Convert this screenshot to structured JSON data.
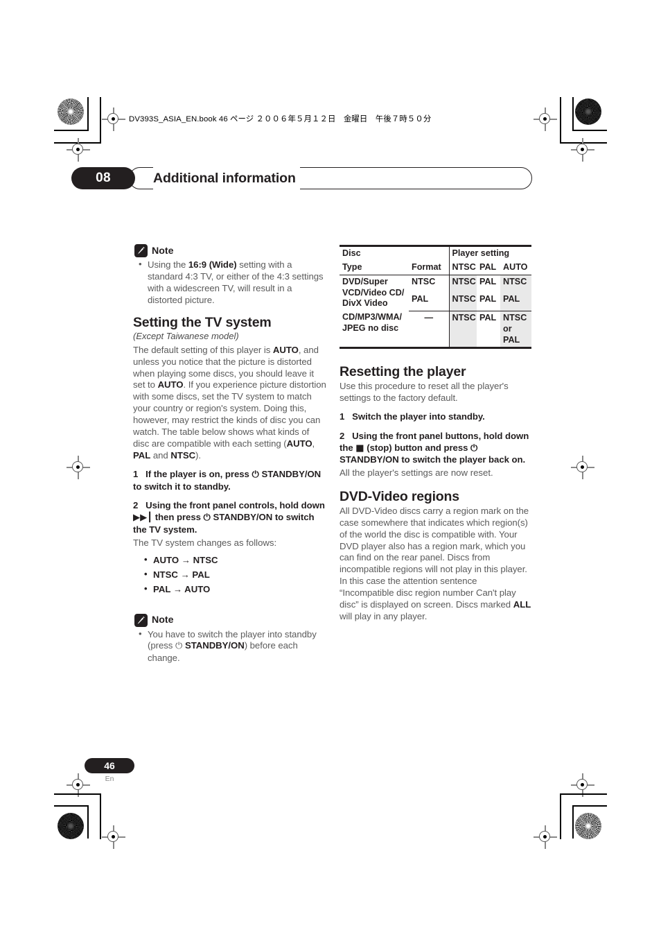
{
  "print_header": {
    "text": "DV393S_ASIA_EN.book  46 ページ  ２００６年５月１２日　金曜日　午後７時５０分"
  },
  "chapter": {
    "number": "08",
    "title": "Additional information"
  },
  "left_column": {
    "note_top": {
      "icon": "pencil-note-icon",
      "label": "Note",
      "items_html": [
        "Using the <b>16:9 (Wide)</b> setting with a standard 4:3 TV, or either of the 4:3 settings with a widescreen TV, will result in a distorted picture."
      ]
    },
    "section": {
      "heading": "Setting the TV system",
      "subheading": "(Except Taiwanese model)",
      "intro_html": "The default setting of this player is <b>AUTO</b>, and unless you notice that the picture is distorted when playing some discs, you should leave it set to <b>AUTO</b>. If you experience picture distortion with some discs, set the TV system to match your country or region's system. Doing this, however, may restrict the kinds of disc you can watch. The table below shows what kinds of disc are compatible with each setting (<b>AUTO</b>, <b>PAL</b> and <b>NTSC</b>).",
      "steps": [
        {
          "number": "1",
          "text_html": "If the player is on, press <span class=\"sym\">&#9211;</span> STANDBY/ON to switch it to standby."
        },
        {
          "number": "2",
          "text_html": "Using the front panel controls, hold down <span class=\"sym\">&#9654;&#9654;&#9475;</span> then press <span class=\"sym\">&#9211;</span> STANDBY/ON to switch the TV system."
        }
      ],
      "after_step_text": "The TV system changes as follows:",
      "transitions": [
        "AUTO → NTSC",
        "NTSC → PAL",
        "PAL → AUTO"
      ]
    },
    "note_bottom": {
      "icon": "pencil-note-icon",
      "label": "Note",
      "items_html": [
        "You have to switch the player into standby (press <span class=\"sym\">&#9211;</span> <b>STANDBY/ON</b>) before each change."
      ]
    }
  },
  "right_column": {
    "table": {
      "header": {
        "disc_label": "Disc",
        "type_label": "Type",
        "format_label": "Format",
        "player_setting_label": "Player setting",
        "setting_cols": [
          "NTSC",
          "PAL",
          "AUTO"
        ]
      },
      "rows": [
        {
          "disc_type": "DVD/Super VCD/Video CD/ DivX Video",
          "formats": [
            {
              "format": "NTSC",
              "ntsc": "NTSC",
              "pal": "PAL",
              "auto": "NTSC"
            },
            {
              "format": "PAL",
              "ntsc": "NTSC",
              "pal": "PAL",
              "auto": "PAL"
            }
          ]
        },
        {
          "disc_type": "CD/MP3/WMA/ JPEG no disc",
          "formats": [
            {
              "format": "—",
              "ntsc": "NTSC",
              "pal": "PAL",
              "auto": "NTSC or PAL"
            }
          ]
        }
      ],
      "shaded_columns": [
        "NTSC",
        "AUTO"
      ],
      "shade_color": "#e9e9e9"
    },
    "resetting": {
      "heading": "Resetting the player",
      "intro": "Use this procedure to reset all the player's settings to the factory default.",
      "steps": [
        {
          "number": "1",
          "text_html": "Switch the player into standby."
        },
        {
          "number": "2",
          "text_html": "Using the front panel buttons, hold down the <span class=\"sym\">&#9632;</span> (stop) button and press <span class=\"sym\">&#9211;</span> STANDBY/ON to switch the player back on."
        }
      ],
      "closing": "All the player's settings are now reset."
    },
    "regions": {
      "heading": "DVD-Video regions",
      "body_html": "All DVD-Video discs carry a region mark on the case somewhere that indicates which region(s) of the world the disc is compatible with. Your DVD player also has a region mark, which you can find on the rear panel. Discs from incompatible regions will not play in this player. In this case the attention sentence “Incompatible disc region number Can't play disc” is displayed on screen. Discs marked <b>ALL</b> will play in any player."
    }
  },
  "footer": {
    "page_number": "46",
    "language": "En"
  }
}
